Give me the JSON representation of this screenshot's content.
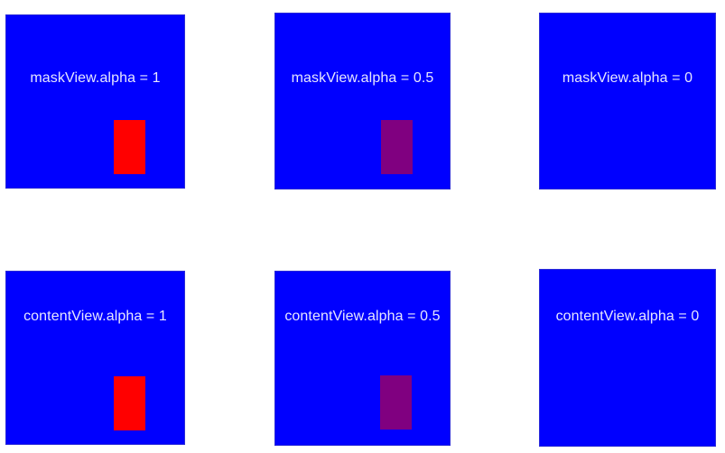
{
  "colors": {
    "background": "#ffffff",
    "panel": "#0000ff",
    "label": "#e7e7ff",
    "swatch_full": "#ff0000",
    "swatch_half": "#800080"
  },
  "panels": [
    {
      "label": "maskView.alpha = 1",
      "swatch_visible": true,
      "swatch_color": "#ff0000"
    },
    {
      "label": "maskView.alpha = 0.5",
      "swatch_visible": true,
      "swatch_color": "#800080"
    },
    {
      "label": "maskView.alpha = 0",
      "swatch_visible": false,
      "swatch_color": ""
    },
    {
      "label": "contentView.alpha = 1",
      "swatch_visible": true,
      "swatch_color": "#ff0000"
    },
    {
      "label": "contentView.alpha = 0.5",
      "swatch_visible": true,
      "swatch_color": "#800080"
    },
    {
      "label": "contentView.alpha = 0",
      "swatch_visible": false,
      "swatch_color": ""
    }
  ]
}
